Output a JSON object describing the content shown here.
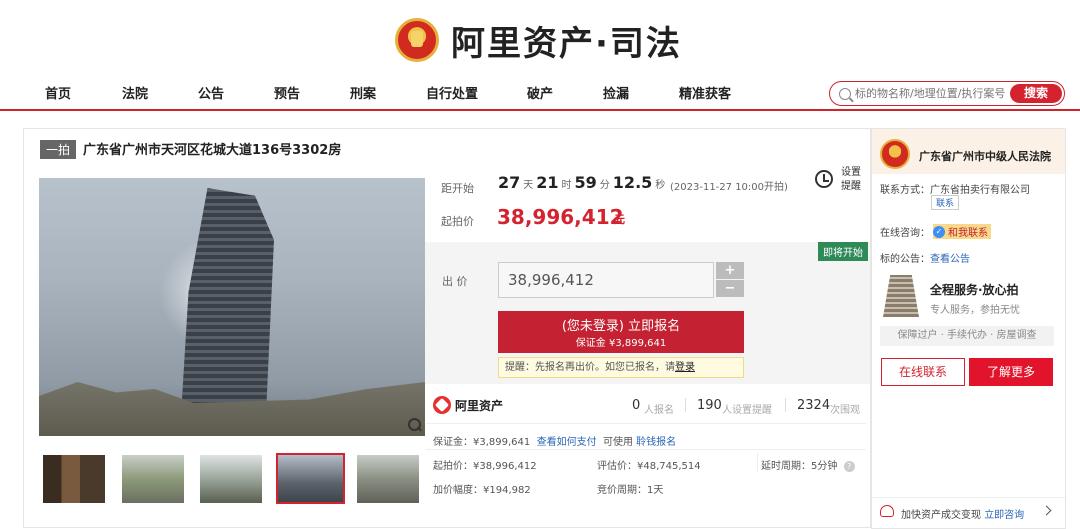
{
  "header": {
    "logo_text": "阿里资产·司法",
    "nav": [
      "首页",
      "法院",
      "公告",
      "预告",
      "刑案",
      "自行处置",
      "破产",
      "捡漏",
      "精准获客"
    ],
    "search_placeholder": "标的物名称/地理位置/执行案号",
    "search_button": "搜索"
  },
  "item": {
    "tag": "一拍",
    "title": "广东省广州市天河区花城大道136号3302房"
  },
  "countdown": {
    "label": "距开始",
    "days": "27",
    "days_unit": "天",
    "hours": "21",
    "hours_unit": "时",
    "minutes": "59",
    "minutes_unit": "分",
    "seconds": "12.5",
    "seconds_unit": "秒",
    "start_date": "(2023-11-27 10:00开拍)",
    "remind_label": "设置提醒"
  },
  "price": {
    "start_label": "起拍价",
    "start_value": "38,996,412",
    "start_unit": "元",
    "badge": "即将开始",
    "bid_label": "出 价",
    "bid_value": "38,996,412",
    "plus": "+",
    "minus": "−",
    "register_line1": "(您未登录) 立即报名",
    "register_line2": "保证金 ¥3,899,641",
    "tip_text": "提醒：先报名再出价。如您已报名，请",
    "tip_link": "登录"
  },
  "stats": {
    "brand": "阿里资产",
    "signed_num": "0",
    "signed_label": "人报名",
    "remind_num": "190",
    "remind_label": "人设置提醒",
    "views_num": "2324",
    "views_label": "次围观"
  },
  "info": {
    "deposit": "保证金：¥3,899,641",
    "deposit_link": "查看如何支付",
    "usable": "可使用",
    "usable_link": "聆钱报名",
    "start_price": "起拍价：¥38,996,412",
    "appraisal": "评估价：¥48,745,514",
    "delay": "延时周期：5分钟",
    "increment": "加价幅度：¥194,982",
    "period": "竞价周期：1天"
  },
  "side": {
    "court": "广东省广州市中级人民法院",
    "contact_label": "联系方式：广东省拍卖行有限公司",
    "contact_chip": "联系",
    "online_label": "在线咨询：",
    "online_chip": "和我联系",
    "notice_label": "标的公告：",
    "notice_link": "查看公告",
    "service_title": "全程服务·放心拍",
    "service_sub": "专人服务，参拍无忧",
    "service_bar": "保障过户 · 手续代办 · 房屋调查",
    "btn_online": "在线联系",
    "btn_more": "了解更多",
    "foot_text": "加快资产成交变现",
    "foot_link": "立即咨询"
  },
  "colors": {
    "brand_red": "#d4232f",
    "link_blue": "#2a66b8",
    "badge_green": "#2e8b57"
  }
}
